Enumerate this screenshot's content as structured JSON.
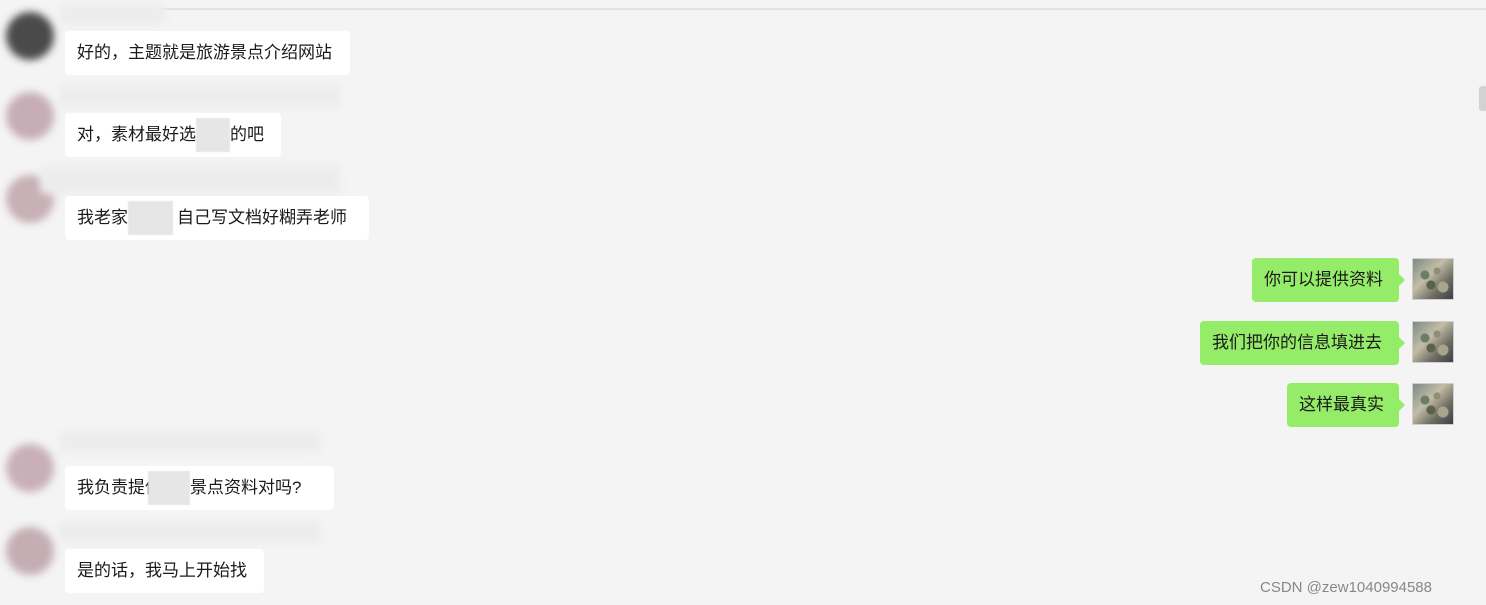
{
  "messages": [
    {
      "id": 1,
      "side": "left",
      "text": "好的，主题就是旅游景点介绍网站"
    },
    {
      "id": 2,
      "side": "left",
      "text_before": "对，素材最好选",
      "text_after": "的吧"
    },
    {
      "id": 3,
      "side": "left",
      "text_before": "我老家",
      "text_after": "自己写文档好糊弄老师"
    },
    {
      "id": 4,
      "side": "right",
      "text": "你可以提供资料"
    },
    {
      "id": 5,
      "side": "right",
      "text": "我们把你的信息填进去"
    },
    {
      "id": 6,
      "side": "right",
      "text": "这样最真实"
    },
    {
      "id": 7,
      "side": "left",
      "text_before": "我负责提供",
      "text_after": "景点资料对吗?"
    },
    {
      "id": 8,
      "side": "left",
      "text": "是的话，我马上开始找"
    }
  ],
  "colors": {
    "sent_bubble": "#95ec69",
    "received_bubble": "#ffffff",
    "background": "#f4f4f4"
  },
  "watermark": "CSDN @zew1040994588"
}
